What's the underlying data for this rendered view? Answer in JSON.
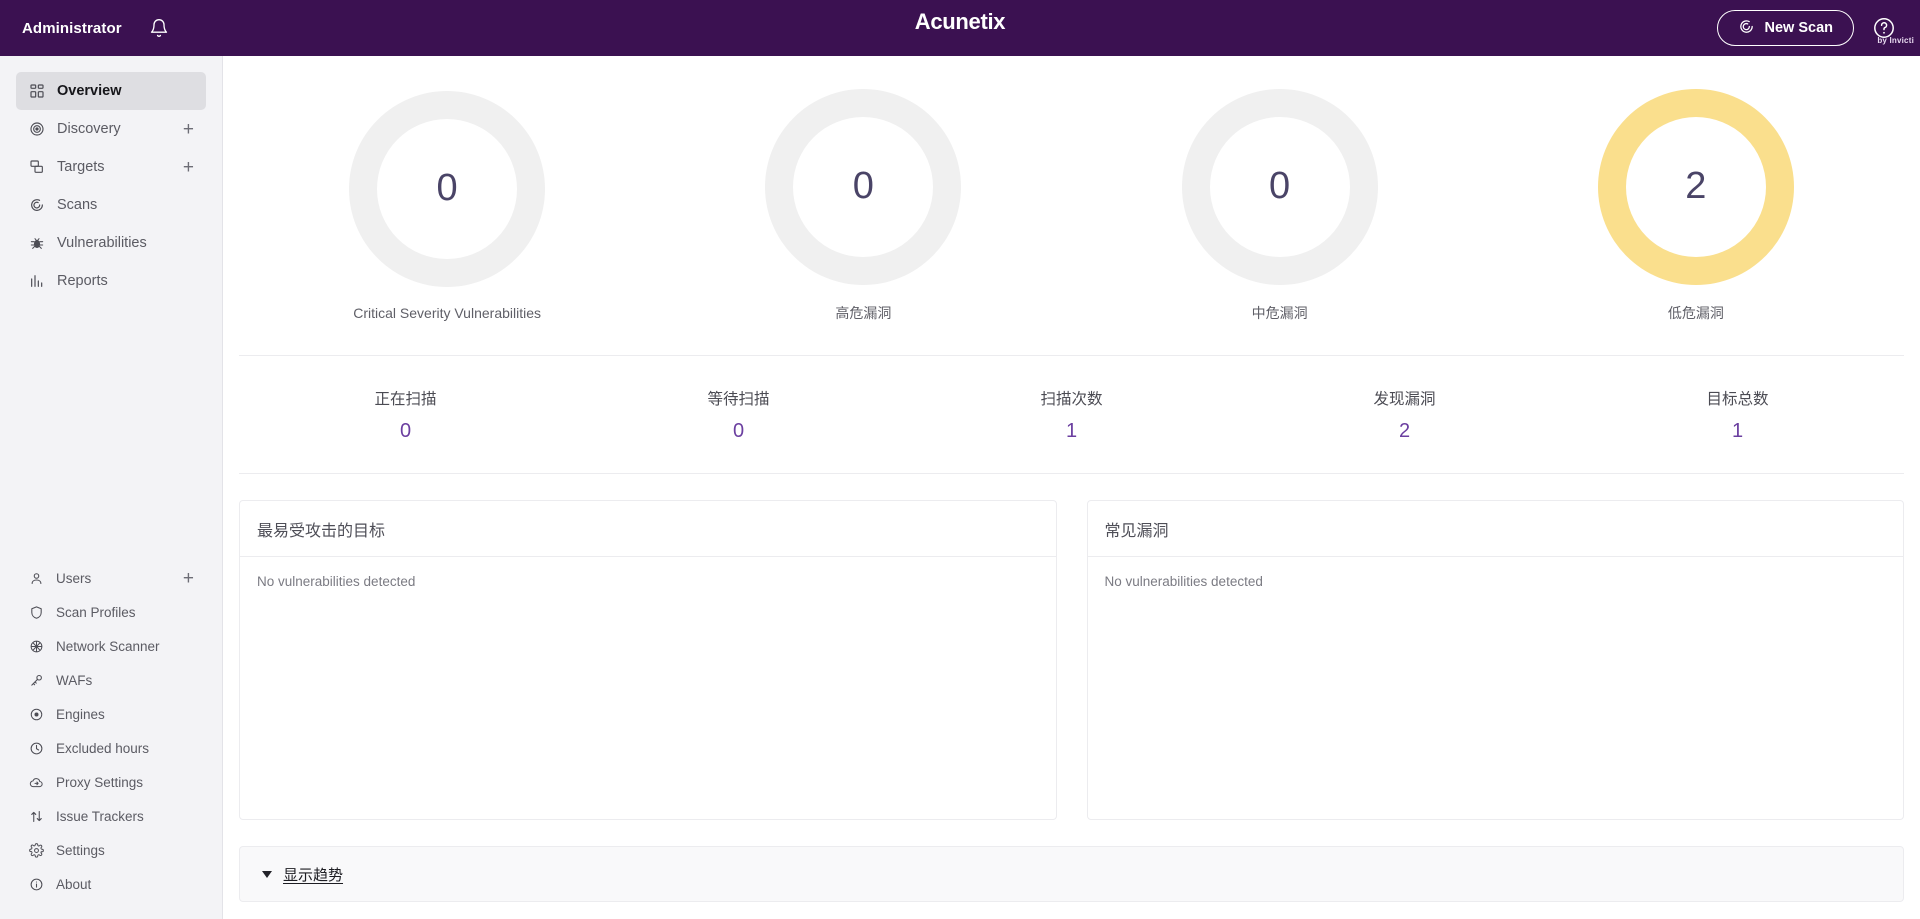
{
  "topbar": {
    "admin_label": "Administrator",
    "notifications_icon": "bell-icon",
    "brand_name": "Acunetix",
    "brand_sub": "by Invicti",
    "new_scan_label": "New Scan",
    "new_scan_icon": "acunetix-swirl-icon",
    "help_icon": "question-circle-icon"
  },
  "sidebar": {
    "primary": [
      {
        "label": "Overview",
        "icon": "grid-icon",
        "active": true,
        "plus": false
      },
      {
        "label": "Discovery",
        "icon": "target-rings-icon",
        "active": false,
        "plus": true
      },
      {
        "label": "Targets",
        "icon": "targets-stack-icon",
        "active": false,
        "plus": true
      },
      {
        "label": "Scans",
        "icon": "acunetix-swirl-icon",
        "active": false,
        "plus": false
      },
      {
        "label": "Vulnerabilities",
        "icon": "bug-icon",
        "active": false,
        "plus": false
      },
      {
        "label": "Reports",
        "icon": "bar-chart-icon",
        "active": false,
        "plus": false
      }
    ],
    "secondary": [
      {
        "label": "Users",
        "icon": "user-icon",
        "plus": true
      },
      {
        "label": "Scan Profiles",
        "icon": "shield-icon",
        "plus": false
      },
      {
        "label": "Network Scanner",
        "icon": "network-scanner-icon",
        "plus": false
      },
      {
        "label": "WAFs",
        "icon": "key-icon",
        "plus": false
      },
      {
        "label": "Engines",
        "icon": "gear-dot-icon",
        "plus": false
      },
      {
        "label": "Excluded hours",
        "icon": "clock-icon",
        "plus": false
      },
      {
        "label": "Proxy Settings",
        "icon": "cloud-arrow-icon",
        "plus": false
      },
      {
        "label": "Issue Trackers",
        "icon": "swap-arrows-icon",
        "plus": false
      },
      {
        "label": "Settings",
        "icon": "gear-icon",
        "plus": false
      },
      {
        "label": "About",
        "icon": "info-circle-icon",
        "plus": false
      }
    ]
  },
  "severity": {
    "items": [
      {
        "label": "Critical Severity Vulnerabilities",
        "value": "0",
        "color": "#f0f0f0"
      },
      {
        "label": "高危漏洞",
        "value": "0",
        "color": "#f0f0f0"
      },
      {
        "label": "中危漏洞",
        "value": "0",
        "color": "#f0f0f0"
      },
      {
        "label": "低危漏洞",
        "value": "2",
        "color": "#fadf8d"
      }
    ]
  },
  "stats": {
    "items": [
      {
        "label": "正在扫描",
        "value": "0"
      },
      {
        "label": "等待扫描",
        "value": "0"
      },
      {
        "label": "扫描次数",
        "value": "1"
      },
      {
        "label": "发现漏洞",
        "value": "2"
      },
      {
        "label": "目标总数",
        "value": "1"
      }
    ]
  },
  "panels": [
    {
      "title": "最易受攻击的目标",
      "empty_text": "No vulnerabilities detected"
    },
    {
      "title": "常见漏洞",
      "empty_text": "No vulnerabilities detected"
    }
  ],
  "trends": {
    "label": "显示趋势",
    "caret_icon": "caret-down-icon"
  },
  "chart_data": {
    "type": "pie",
    "title": "Vulnerability severity summary",
    "categories": [
      "Critical Severity Vulnerabilities",
      "高危漏洞",
      "中危漏洞",
      "低危漏洞"
    ],
    "values": [
      0,
      0,
      0,
      2
    ],
    "colors": [
      "#f0f0f0",
      "#f0f0f0",
      "#f0f0f0",
      "#fadf8d"
    ],
    "legend": "below-each-donut",
    "grid": false
  }
}
